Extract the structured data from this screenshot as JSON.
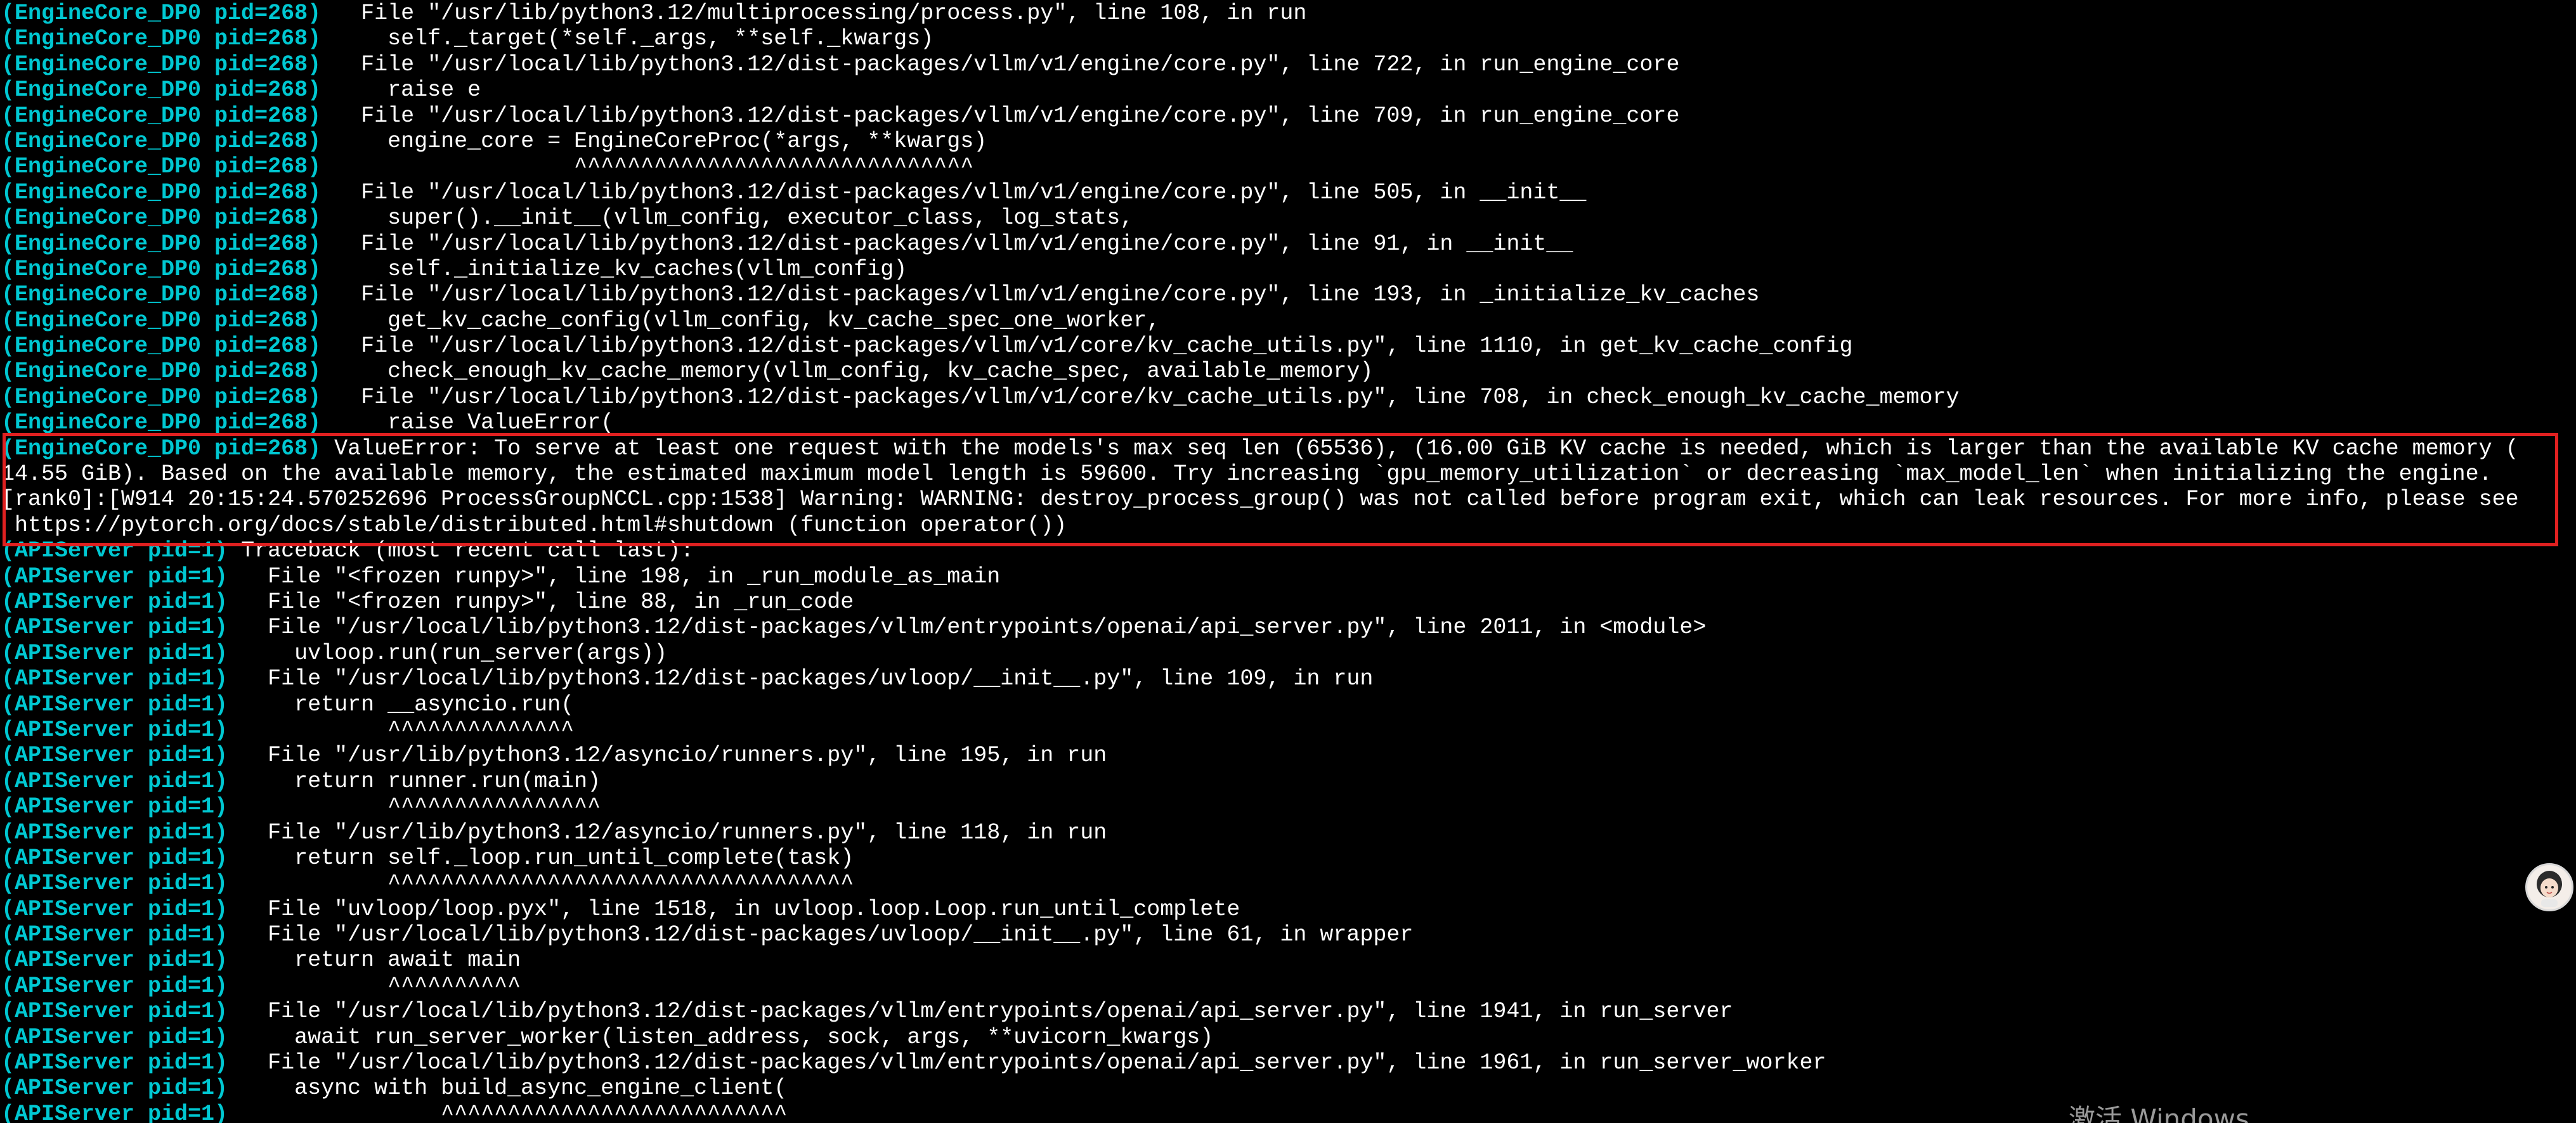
{
  "terminal": {
    "lines": [
      {
        "prefix": "(EngineCore_DP0 pid=268)",
        "text": "   File \"/usr/lib/python3.12/multiprocessing/process.py\", line 108, in run"
      },
      {
        "prefix": "(EngineCore_DP0 pid=268)",
        "text": "     self._target(*self._args, **self._kwargs)"
      },
      {
        "prefix": "(EngineCore_DP0 pid=268)",
        "text": "   File \"/usr/local/lib/python3.12/dist-packages/vllm/v1/engine/core.py\", line 722, in run_engine_core"
      },
      {
        "prefix": "(EngineCore_DP0 pid=268)",
        "text": "     raise e"
      },
      {
        "prefix": "(EngineCore_DP0 pid=268)",
        "text": "   File \"/usr/local/lib/python3.12/dist-packages/vllm/v1/engine/core.py\", line 709, in run_engine_core"
      },
      {
        "prefix": "(EngineCore_DP0 pid=268)",
        "text": "     engine_core = EngineCoreProc(*args, **kwargs)"
      },
      {
        "prefix": "(EngineCore_DP0 pid=268)",
        "text": "                   ^^^^^^^^^^^^^^^^^^^^^^^^^^^^^^"
      },
      {
        "prefix": "(EngineCore_DP0 pid=268)",
        "text": "   File \"/usr/local/lib/python3.12/dist-packages/vllm/v1/engine/core.py\", line 505, in __init__"
      },
      {
        "prefix": "(EngineCore_DP0 pid=268)",
        "text": "     super().__init__(vllm_config, executor_class, log_stats,"
      },
      {
        "prefix": "(EngineCore_DP0 pid=268)",
        "text": "   File \"/usr/local/lib/python3.12/dist-packages/vllm/v1/engine/core.py\", line 91, in __init__"
      },
      {
        "prefix": "(EngineCore_DP0 pid=268)",
        "text": "     self._initialize_kv_caches(vllm_config)"
      },
      {
        "prefix": "(EngineCore_DP0 pid=268)",
        "text": "   File \"/usr/local/lib/python3.12/dist-packages/vllm/v1/engine/core.py\", line 193, in _initialize_kv_caches"
      },
      {
        "prefix": "(EngineCore_DP0 pid=268)",
        "text": "     get_kv_cache_config(vllm_config, kv_cache_spec_one_worker,"
      },
      {
        "prefix": "(EngineCore_DP0 pid=268)",
        "text": "   File \"/usr/local/lib/python3.12/dist-packages/vllm/v1/core/kv_cache_utils.py\", line 1110, in get_kv_cache_config"
      },
      {
        "prefix": "(EngineCore_DP0 pid=268)",
        "text": "     check_enough_kv_cache_memory(vllm_config, kv_cache_spec, available_memory)"
      },
      {
        "prefix": "(EngineCore_DP0 pid=268)",
        "text": "   File \"/usr/local/lib/python3.12/dist-packages/vllm/v1/core/kv_cache_utils.py\", line 708, in check_enough_kv_cache_memory"
      },
      {
        "prefix": "(EngineCore_DP0 pid=268)",
        "text": "     raise ValueError("
      },
      {
        "prefix": "(EngineCore_DP0 pid=268)",
        "text": " ValueError: To serve at least one request with the models's max seq len (65536), (16.00 GiB KV cache is needed, which is larger than the available KV cache memory ("
      },
      {
        "prefix": "",
        "text": "14.55 GiB). Based on the available memory, the estimated maximum model length is 59600. Try increasing `gpu_memory_utilization` or decreasing `max_model_len` when initializing the engine."
      },
      {
        "prefix": "",
        "text": "[rank0]:[W914 20:15:24.570252696 ProcessGroupNCCL.cpp:1538] Warning: WARNING: destroy_process_group() was not called before program exit, which can leak resources. For more info, please see"
      },
      {
        "prefix": "",
        "text": " https://pytorch.org/docs/stable/distributed.html#shutdown (function operator())"
      },
      {
        "prefix": "(APIServer pid=1)",
        "text": " Traceback (most recent call last):"
      },
      {
        "prefix": "(APIServer pid=1)",
        "text": "   File \"<frozen runpy>\", line 198, in _run_module_as_main"
      },
      {
        "prefix": "(APIServer pid=1)",
        "text": "   File \"<frozen runpy>\", line 88, in _run_code"
      },
      {
        "prefix": "(APIServer pid=1)",
        "text": "   File \"/usr/local/lib/python3.12/dist-packages/vllm/entrypoints/openai/api_server.py\", line 2011, in <module>"
      },
      {
        "prefix": "(APIServer pid=1)",
        "text": "     uvloop.run(run_server(args))"
      },
      {
        "prefix": "(APIServer pid=1)",
        "text": "   File \"/usr/local/lib/python3.12/dist-packages/uvloop/__init__.py\", line 109, in run"
      },
      {
        "prefix": "(APIServer pid=1)",
        "text": "     return __asyncio.run("
      },
      {
        "prefix": "(APIServer pid=1)",
        "text": "            ^^^^^^^^^^^^^^"
      },
      {
        "prefix": "(APIServer pid=1)",
        "text": "   File \"/usr/lib/python3.12/asyncio/runners.py\", line 195, in run"
      },
      {
        "prefix": "(APIServer pid=1)",
        "text": "     return runner.run(main)"
      },
      {
        "prefix": "(APIServer pid=1)",
        "text": "            ^^^^^^^^^^^^^^^^"
      },
      {
        "prefix": "(APIServer pid=1)",
        "text": "   File \"/usr/lib/python3.12/asyncio/runners.py\", line 118, in run"
      },
      {
        "prefix": "(APIServer pid=1)",
        "text": "     return self._loop.run_until_complete(task)"
      },
      {
        "prefix": "(APIServer pid=1)",
        "text": "            ^^^^^^^^^^^^^^^^^^^^^^^^^^^^^^^^^^^"
      },
      {
        "prefix": "(APIServer pid=1)",
        "text": "   File \"uvloop/loop.pyx\", line 1518, in uvloop.loop.Loop.run_until_complete"
      },
      {
        "prefix": "(APIServer pid=1)",
        "text": "   File \"/usr/local/lib/python3.12/dist-packages/uvloop/__init__.py\", line 61, in wrapper"
      },
      {
        "prefix": "(APIServer pid=1)",
        "text": "     return await main"
      },
      {
        "prefix": "(APIServer pid=1)",
        "text": "            ^^^^^^^^^^"
      },
      {
        "prefix": "(APIServer pid=1)",
        "text": "   File \"/usr/local/lib/python3.12/dist-packages/vllm/entrypoints/openai/api_server.py\", line 1941, in run_server"
      },
      {
        "prefix": "(APIServer pid=1)",
        "text": "     await run_server_worker(listen_address, sock, args, **uvicorn_kwargs)"
      },
      {
        "prefix": "(APIServer pid=1)",
        "text": "   File \"/usr/local/lib/python3.12/dist-packages/vllm/entrypoints/openai/api_server.py\", line 1961, in run_server_worker"
      },
      {
        "prefix": "(APIServer pid=1)",
        "text": "     async with build_async_engine_client("
      },
      {
        "prefix": "(APIServer pid=1)",
        "text": "                ^^^^^^^^^^^^^^^^^^^^^^^^^^"
      }
    ]
  },
  "watermark": {
    "text": "激活 Windows"
  },
  "avatar": {
    "icon": "avatar-icon"
  },
  "colors": {
    "background": "#000000",
    "prefix": "#00c8d2",
    "text": "#ffffff",
    "highlight_border": "#e02020"
  }
}
